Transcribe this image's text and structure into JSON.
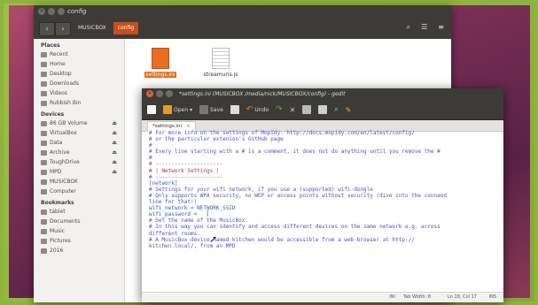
{
  "file_manager": {
    "title": "config",
    "crumb_prev": "MUSICBOX",
    "crumb_current": "config",
    "sidebar": {
      "places_title": "Places",
      "places": [
        "Recent",
        "Home",
        "Desktop",
        "Downloads",
        "Videos",
        "Rubbish Bin"
      ],
      "devices_title": "Devices",
      "devices": [
        "86 GB Volume",
        "VirtualBox",
        "Data",
        "Archive",
        "ToughDrive",
        "MPD",
        "MUSICBOX",
        "Computer"
      ],
      "bookmarks_title": "Bookmarks",
      "bookmarks": [
        "tablet",
        "Documents",
        "Music",
        "Pictures",
        "2016"
      ]
    },
    "files": [
      {
        "name": "settings.ini",
        "selected": true
      },
      {
        "name": "streamuris.js",
        "selected": false
      }
    ]
  },
  "editor": {
    "title": "*settings.ini (MUSICBOX /media/nick/MUSICBOX/config) - gedit",
    "toolbar": {
      "open": "Open",
      "save": "Save",
      "undo": "Undo"
    },
    "tab_label": "*settings.ini",
    "lines": [
      "# For more info on the settings of MopIdy: http://docs.mopidy.com/en/latest/config/",
      "# or the particular extenion's GitHub page",
      "#",
      "# Every line starting with a # is a comment, it does not do anything until you remove the #",
      "#",
      "# ---------------------",
      "# | Network Settings |",
      "# ---------------------",
      "[network]",
      "# Settings for your wifi network, if you use a (supported) wifi-dongle",
      "# Only supports WPA security, no WEP or access points without security (dive into the connaod",
      "line for that!)",
      "wifi_network = NETWORK_SSID",
      "wifi_password = ",
      "",
      "# Set the name of the MusicBox.",
      "# In this way you can identify and access different devices on the same network e.g. across",
      "different rooms.",
      "# A MusicBox device named kitchen would be accessible from a web browser at http://",
      "kitchen.local/, from an MPD"
    ],
    "status": {
      "mode": "INI",
      "tab_width": "Tab Width: 8",
      "position": "Ln 18, Col 17",
      "ins": "INS"
    }
  }
}
